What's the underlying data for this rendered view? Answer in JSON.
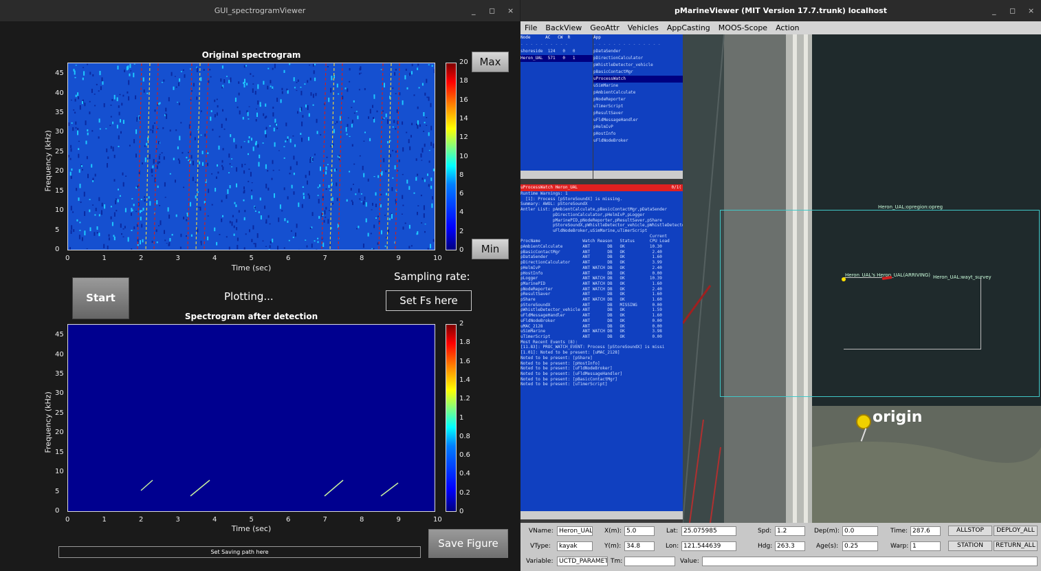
{
  "left": {
    "window_title": "GUI_spectrogramViewer",
    "ctl": {
      "min": "_",
      "max": "◻",
      "close": "×"
    },
    "plot1": {
      "title": "Original spectrogram",
      "xlabel": "Time (sec)",
      "ylabel": "Frequency (kHz)",
      "xticks": [
        "0",
        "1",
        "2",
        "3",
        "4",
        "5",
        "6",
        "7",
        "8",
        "9",
        "10"
      ],
      "yticks": [
        "0",
        "5",
        "10",
        "15",
        "20",
        "25",
        "30",
        "35",
        "40",
        "45"
      ],
      "cticks": [
        "0",
        "2",
        "4",
        "6",
        "8",
        "10",
        "12",
        "14",
        "16",
        "18",
        "20"
      ]
    },
    "plot2": {
      "title": "Spectrogram after detection",
      "xlabel": "Time (sec)",
      "ylabel": "Frequency (kHz)",
      "xticks": [
        "0",
        "1",
        "2",
        "3",
        "4",
        "5",
        "6",
        "7",
        "8",
        "9",
        "10"
      ],
      "yticks": [
        "0",
        "5",
        "10",
        "15",
        "20",
        "25",
        "30",
        "35",
        "40",
        "45"
      ],
      "cticks": [
        "0",
        "0.2",
        "0.4",
        "0.6",
        "0.8",
        "1",
        "1.2",
        "1.4",
        "1.6",
        "1.8",
        "2"
      ]
    },
    "max_label": "Max",
    "min_label": "Min",
    "start_label": "Start",
    "plotting_label": "Plotting...",
    "sampling_label": "Sampling rate:",
    "setfs_label": "Set Fs here",
    "save_label": "Save Figure",
    "save_path_label": "Set Saving path here"
  },
  "right": {
    "window_title": "pMarineViewer (MIT Version 17.7.trunk) localhost",
    "ctl": {
      "min": "_",
      "max": "◻",
      "close": "×"
    },
    "menu": [
      "File",
      "BackView",
      "GeoAttr",
      "Vehicles",
      "AppCasting",
      "MOOS-Scope",
      "Action"
    ],
    "node_header": "Node      AC   CW  R",
    "nodes": [
      "shoreside  124   0   0",
      "Heron_UAL  571   0   1"
    ],
    "app_header": "App",
    "apps": [
      "pDataSender",
      "pDirectionCalculator",
      "pWhistleDetector_vehicle",
      "pBasicContactMgr",
      "uProcessWatch",
      "uSimMarine",
      "pAmbientCalculate",
      "pNodeReporter",
      "uTimerScript",
      "pResultSaver",
      "uFldMessageHandler",
      "pHelmIvP",
      "pHostInfo",
      "uFldNodeBroker"
    ],
    "selected_app": "uProcessWatch",
    "appcast_header": "uProcessWatch Heron_UAL",
    "appcast_header_right": "0/1(",
    "appcast_lines": [
      "Runtime Warnings: 1",
      "  [1]: Process [pStoreSoundX] is missing.",
      "",
      "Summary: AWOL: pStoreSoundX",
      "",
      "Antler List: pAmbientCalculate,pBasicContactMgr,pDataSender",
      "             pDirectionCalculator,pHelmIvP,pLogger",
      "             pMarinePID,pNodeReporter,pResultSaver,pShare",
      "             pStoreSoundX,pWhistleDetector_vehicle,pWhistleDetector",
      "             uFldNodeBroker,uSimMarine,uTimerScript",
      "",
      "                                                    Current",
      "ProcName                 Watch Reason   Status      CPU Load",
      "",
      "pAmbientCalculate        ANT       DB   OK          10.30",
      "pBasicContactMgr         ANT       DB   OK           2.40",
      "pDataSender              ANT       DB   OK           1.60",
      "pDirectionCalculator     ANT       DB   OK           3.99",
      "pHelmIvP                 ANT WATCH DB   OK           2.40",
      "pHostInfo                ANT       DB   OK           0.00",
      "pLogger                  ANT WATCH DB   OK          10.39",
      "pMarinePID               ANT WATCH DB   OK           1.60",
      "pNodeReporter            ANT WATCH DB   OK           2.40",
      "pResultSaver             ANT       DB   OK           1.60",
      "pShare                   ANT WATCH DB   OK           1.60",
      "pStoreSoundX             ANT       DB   MISSING      0.00",
      "pWhistleDetector_vehicle ANT       DB   OK           1.59",
      "uFldMessageHandler       ANT       DB   OK           1.60",
      "uFldNodeBroker           ANT       DB   OK           0.00",
      "uMAC_2128                ANT       DB   OK           0.00",
      "uSimMarine               ANT WATCH DB   OK           3.98",
      "uTimerScript             ANT       DB   OK           0.00",
      "",
      "Most Recent Events (8):",
      "",
      "[11.83]: PROC_WATCH_EVENT: Process [pStoreSoundX] is missi",
      "[1.01]: Noted to be present: [uMAC_2128]",
      "Noted to be present: [pShare]",
      "Noted to be present: [pHostInfo]",
      "Noted to be present: [uFldNodeBroker]",
      "Noted to be present: [uFldMessageHandler]",
      "Noted to be present: [pBasicContactMgr]",
      "Noted to be present: [uTimerScript]"
    ],
    "map": {
      "region_label": "Heron_UAL:opregion:opreg",
      "vehicle_label": "Heron_UAL's Heron_UAL(ARRIVING)",
      "survey_label": "Heron_UAL:wayt_survey",
      "origin_label": "origin"
    },
    "bottom": {
      "vname_label": "VName:",
      "vname": "Heron_UAL",
      "vtype_label": "VType:",
      "vtype": "kayak",
      "xm_label": "X(m):",
      "xm": "5.0",
      "ym_label": "Y(m):",
      "ym": "34.8",
      "lat_label": "Lat:",
      "lat": "25.075985",
      "lon_label": "Lon:",
      "lon": "121.544639",
      "spd_label": "Spd:",
      "spd": "1.2",
      "hdg_label": "Hdg:",
      "hdg": "263.3",
      "dep_label": "Dep(m):",
      "dep": "0.0",
      "age_label": "Age(s):",
      "age": "0.25",
      "time_label": "Time:",
      "time": "287.6",
      "warp_label": "Warp:",
      "warp": "1",
      "allstop": "ALLSTOP",
      "deploy_all": "DEPLOY_ALL",
      "station": "STATION",
      "return_all": "RETURN_ALL",
      "variable_label": "Variable:",
      "variable": "UCTD_PARAMET",
      "tm_label": "Tm:",
      "tm": "",
      "value_label": "Value:",
      "value": ""
    }
  }
}
